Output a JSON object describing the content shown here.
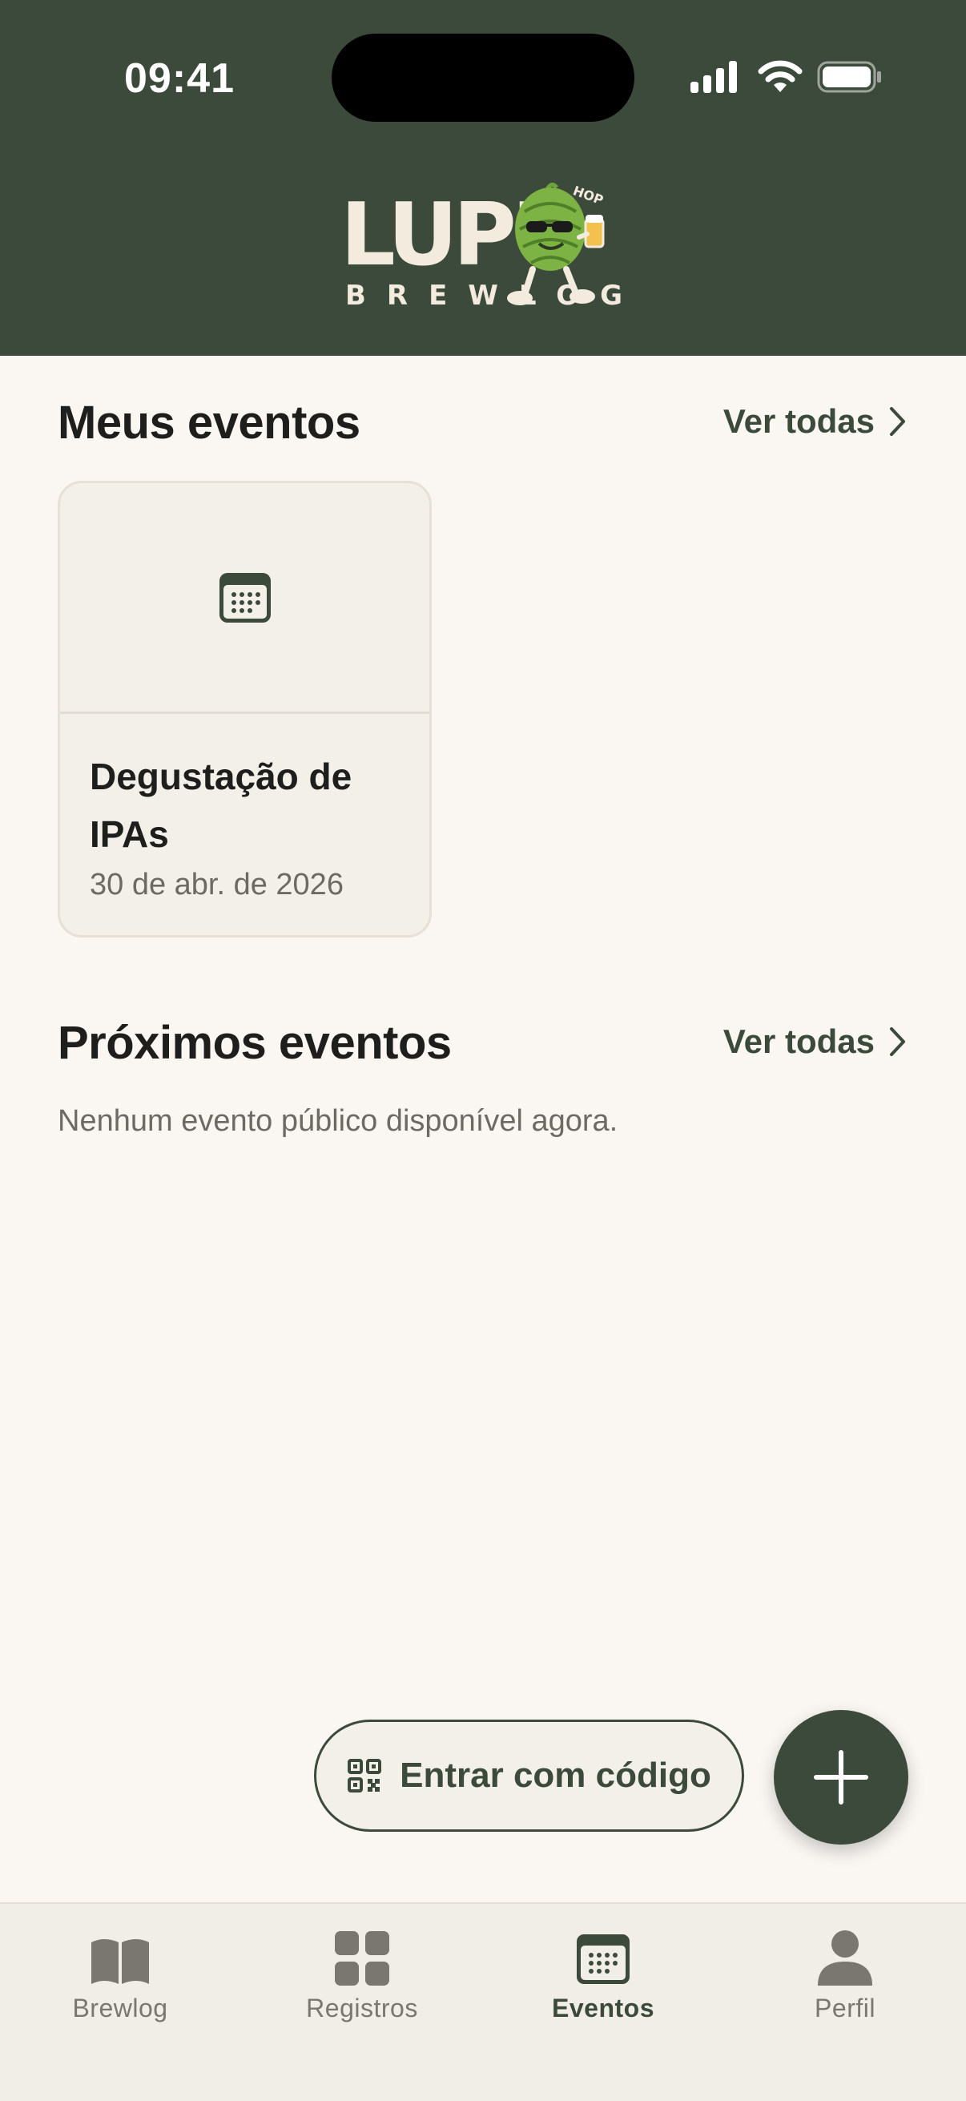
{
  "status_bar": {
    "time": "09:41"
  },
  "brand": {
    "word": "LUPU",
    "subtitle": "BREWLOG",
    "badge": "HOP"
  },
  "my_events": {
    "title": "Meus eventos",
    "see_all": "Ver todas",
    "events": [
      {
        "name": "Degustação de IPAs",
        "date": "30 de abr. de 2026"
      }
    ]
  },
  "upcoming_events": {
    "title": "Próximos eventos",
    "see_all": "Ver todas",
    "empty_message": "Nenhum evento público disponível agora."
  },
  "actions": {
    "join_code_label": "Entrar com código",
    "add_icon": "plus-icon"
  },
  "tabs": [
    {
      "label": "Brewlog",
      "icon": "book-icon",
      "active": false
    },
    {
      "label": "Registros",
      "icon": "grid-icon",
      "active": false
    },
    {
      "label": "Eventos",
      "icon": "calendar-icon",
      "active": true
    },
    {
      "label": "Perfil",
      "icon": "person-icon",
      "active": false
    }
  ],
  "colors": {
    "primary": "#3C4A3B",
    "background": "#FAF7F3",
    "card": "#F3EFE9",
    "cream": "#F3EBDD",
    "muted_text": "#6D6A64",
    "inactive_tab": "#7A7670"
  }
}
